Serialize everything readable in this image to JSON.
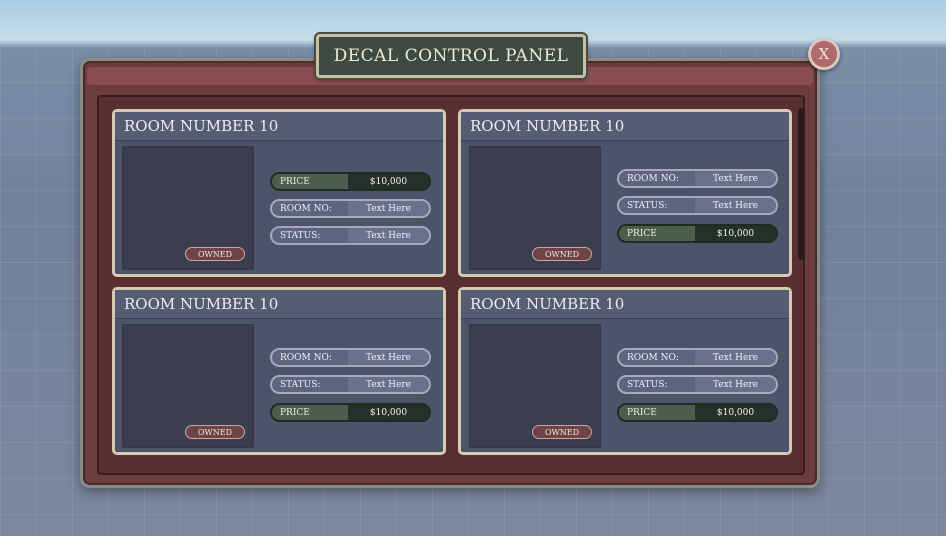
{
  "panel": {
    "title": "DECAL CONTROL PANEL",
    "close_label": "X"
  },
  "cards": [
    {
      "title": "ROOM NUMBER 10",
      "badge": "OWNED",
      "fields": [
        {
          "type": "price",
          "label": "PRICE",
          "value": "$10,000"
        },
        {
          "type": "text",
          "label": "ROOM NO:",
          "value": "Text Here"
        },
        {
          "type": "text",
          "label": "STATUS:",
          "value": "Text Here"
        }
      ]
    },
    {
      "title": "ROOM NUMBER 10",
      "badge": "OWNED",
      "fields": [
        {
          "type": "text",
          "label": "ROOM NO:",
          "value": "Text Here"
        },
        {
          "type": "text",
          "label": "STATUS:",
          "value": "Text Here"
        },
        {
          "type": "price",
          "label": "PRICE",
          "value": "$10,000"
        }
      ]
    },
    {
      "title": "ROOM NUMBER 10",
      "badge": "OWNED",
      "fields": [
        {
          "type": "text",
          "label": "ROOM NO:",
          "value": "Text Here"
        },
        {
          "type": "text",
          "label": "STATUS:",
          "value": "Text Here"
        },
        {
          "type": "price",
          "label": "PRICE",
          "value": "$10,000"
        }
      ]
    },
    {
      "title": "ROOM NUMBER 10",
      "badge": "OWNED",
      "fields": [
        {
          "type": "text",
          "label": "ROOM NO:",
          "value": "Text Here"
        },
        {
          "type": "text",
          "label": "STATUS:",
          "value": "Text Here"
        },
        {
          "type": "price",
          "label": "PRICE",
          "value": "$10,000"
        }
      ]
    }
  ]
}
